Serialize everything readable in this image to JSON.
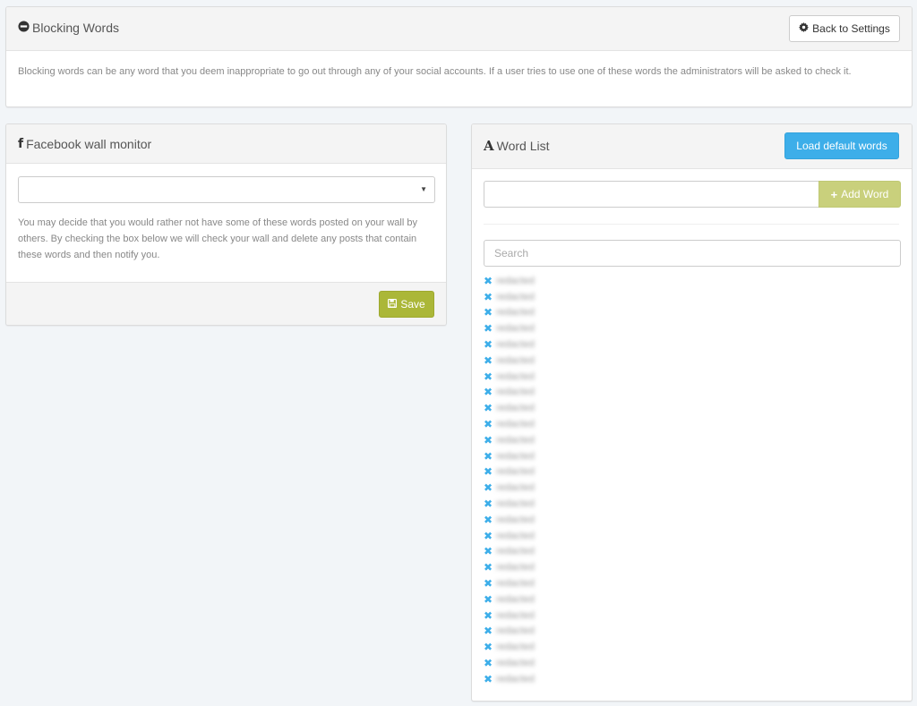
{
  "top_panel": {
    "title": "Blocking Words",
    "title_icon": "minus-circle-icon",
    "back_button": {
      "label": "Back to Settings",
      "icon": "gear-icon"
    },
    "description": "Blocking words can be any word that you deem inappropriate to go out through any of your social accounts. If a user tries to use one of these words the administrators will be asked to check it."
  },
  "facebook_panel": {
    "title": "Facebook wall monitor",
    "title_icon": "facebook-icon",
    "select": {
      "value": "",
      "caret_icon": "caret-down-icon"
    },
    "description": "You may decide that you would rather not have some of these words posted on your wall by others. By checking the box below we will check your wall and delete any posts that contain these words and then notify you.",
    "save_button": {
      "label": "Save",
      "icon": "floppy-disk-icon"
    }
  },
  "word_panel": {
    "title": "Word List",
    "title_icon": "font-icon",
    "load_button": {
      "label": "Load default words"
    },
    "add_input": {
      "value": "",
      "placeholder": ""
    },
    "add_button": {
      "label": "Add Word",
      "icon": "plus-icon"
    },
    "search": {
      "value": "",
      "placeholder": "Search"
    },
    "remove_icon_glyph": "✖",
    "words": [
      "redacted",
      "redacted",
      "redacted",
      "redacted",
      "redacted",
      "redacted",
      "redacted",
      "redacted",
      "redacted",
      "redacted",
      "redacted",
      "redacted",
      "redacted",
      "redacted",
      "redacted",
      "redacted",
      "redacted",
      "redacted",
      "redacted",
      "redacted",
      "redacted",
      "redacted",
      "redacted",
      "redacted",
      "redacted",
      "redacted"
    ],
    "words_note": "Word entries are blurred in the screenshot (26 entries)"
  },
  "colors": {
    "background": "#f2f5f8",
    "accent_blue": "#3daee9",
    "save_green": "#abb738",
    "add_green": "#c9d07c"
  }
}
